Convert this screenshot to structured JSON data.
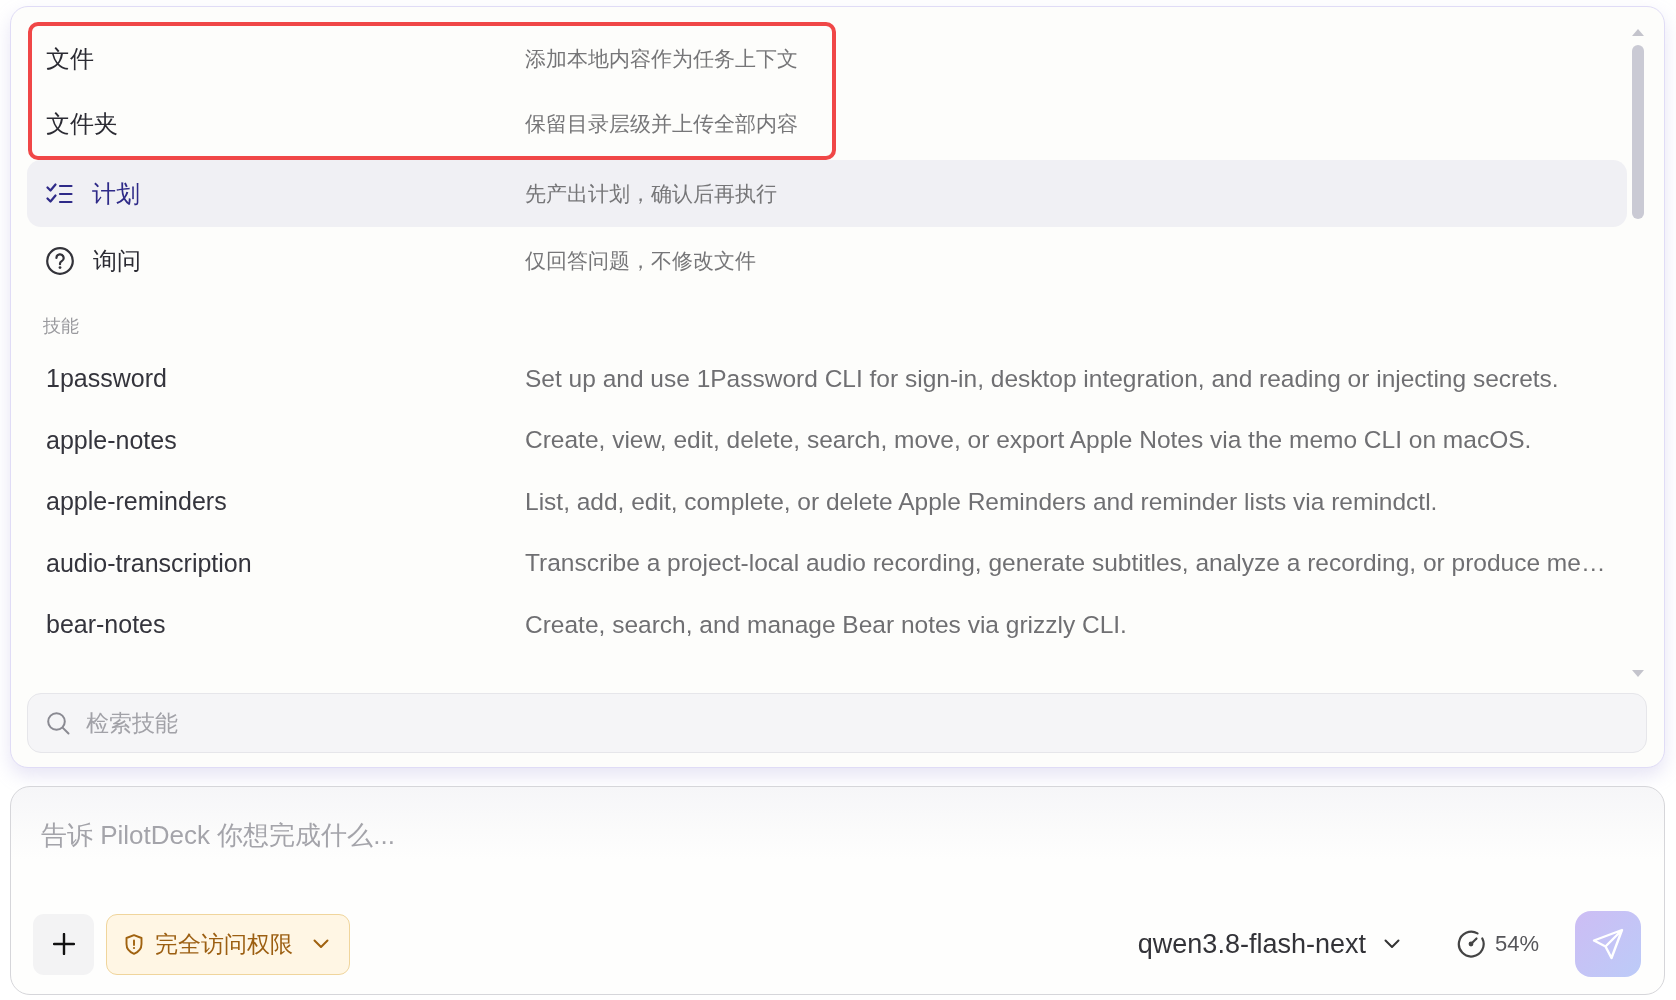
{
  "actions": [
    {
      "kind": "attach",
      "label": "文件",
      "description": "添加本地内容作为任务上下文",
      "selected": false,
      "outlined": true
    },
    {
      "kind": "attach",
      "label": "文件夹",
      "description": "保留目录层级并上传全部内容",
      "selected": false,
      "outlined": true
    },
    {
      "kind": "plan",
      "label": "计划",
      "description": "先产出计划，确认后再执行",
      "selected": true,
      "outlined": false
    },
    {
      "kind": "ask",
      "label": "询问",
      "description": "仅回答问题，不修改文件",
      "selected": false,
      "outlined": false
    }
  ],
  "skills": {
    "heading": "技能",
    "items": [
      {
        "name": "1password",
        "description": "Set up and use 1Password CLI for sign-in, desktop integration, and reading or injecting secrets.",
        "selected": false
      },
      {
        "name": "apple-notes",
        "description": "Create, view, edit, delete, search, move, or export Apple Notes via the memo CLI on macOS.",
        "selected": false
      },
      {
        "name": "apple-reminders",
        "description": "List, add, edit, complete, or delete Apple Reminders and reminder lists via remindctl.",
        "selected": false
      },
      {
        "name": "audio-transcription",
        "description": "Transcribe a project-local audio recording, generate subtitles, analyze a recording, or produce me…",
        "selected": false
      },
      {
        "name": "bear-notes",
        "description": "Create, search, and manage Bear notes via grizzly CLI.",
        "selected": false
      }
    ]
  },
  "skill_search": {
    "placeholder": "检索技能"
  },
  "composer": {
    "placeholder": "告诉 PilotDeck 你想完成什么...",
    "permission": "完全访问权限",
    "model": "qwen3.8-flash-next",
    "context_usage": "54%"
  }
}
